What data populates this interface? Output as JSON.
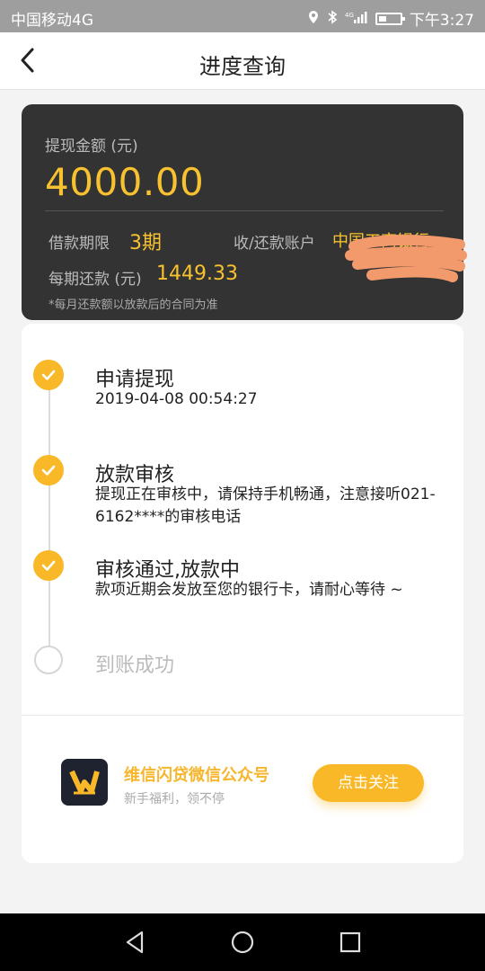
{
  "status_bar": {
    "carrier": "中国移动4G",
    "network": "4G",
    "time": "下午3:27"
  },
  "header": {
    "title": "进度查询",
    "back_icon": "back-arrow-icon"
  },
  "card": {
    "amount_label": "提现金额 (元)",
    "amount": "4000.00",
    "term_label": "借款期限",
    "term_value": "3期",
    "account_label": "收/还款账户",
    "bank_value": "中国工商银行",
    "monthly_label": "每期还款 (元)",
    "monthly_value": "1449.33",
    "note": "*每月还款额以放款后的合同为准"
  },
  "steps": [
    {
      "title": "申请提现",
      "desc": "2019-04-08 00:54:27",
      "done": true
    },
    {
      "title": "放款审核",
      "desc": "提现正在审核中，请保持手机畅通，注意接听021-6162****的审核电话",
      "done": true
    },
    {
      "title": "审核通过,放款中",
      "desc": "款项近期会发放至您的银行卡，请耐心等待 ~",
      "done": true
    },
    {
      "title": "到账成功",
      "desc": "",
      "done": false
    }
  ],
  "wechat": {
    "title": "维信闪贷微信公众号",
    "subtitle": "新手福利，领不停",
    "button": "点击关注"
  },
  "colors": {
    "accent": "#f8b827",
    "card_bg": "#333333",
    "status_bar": "#9e9e9e"
  }
}
